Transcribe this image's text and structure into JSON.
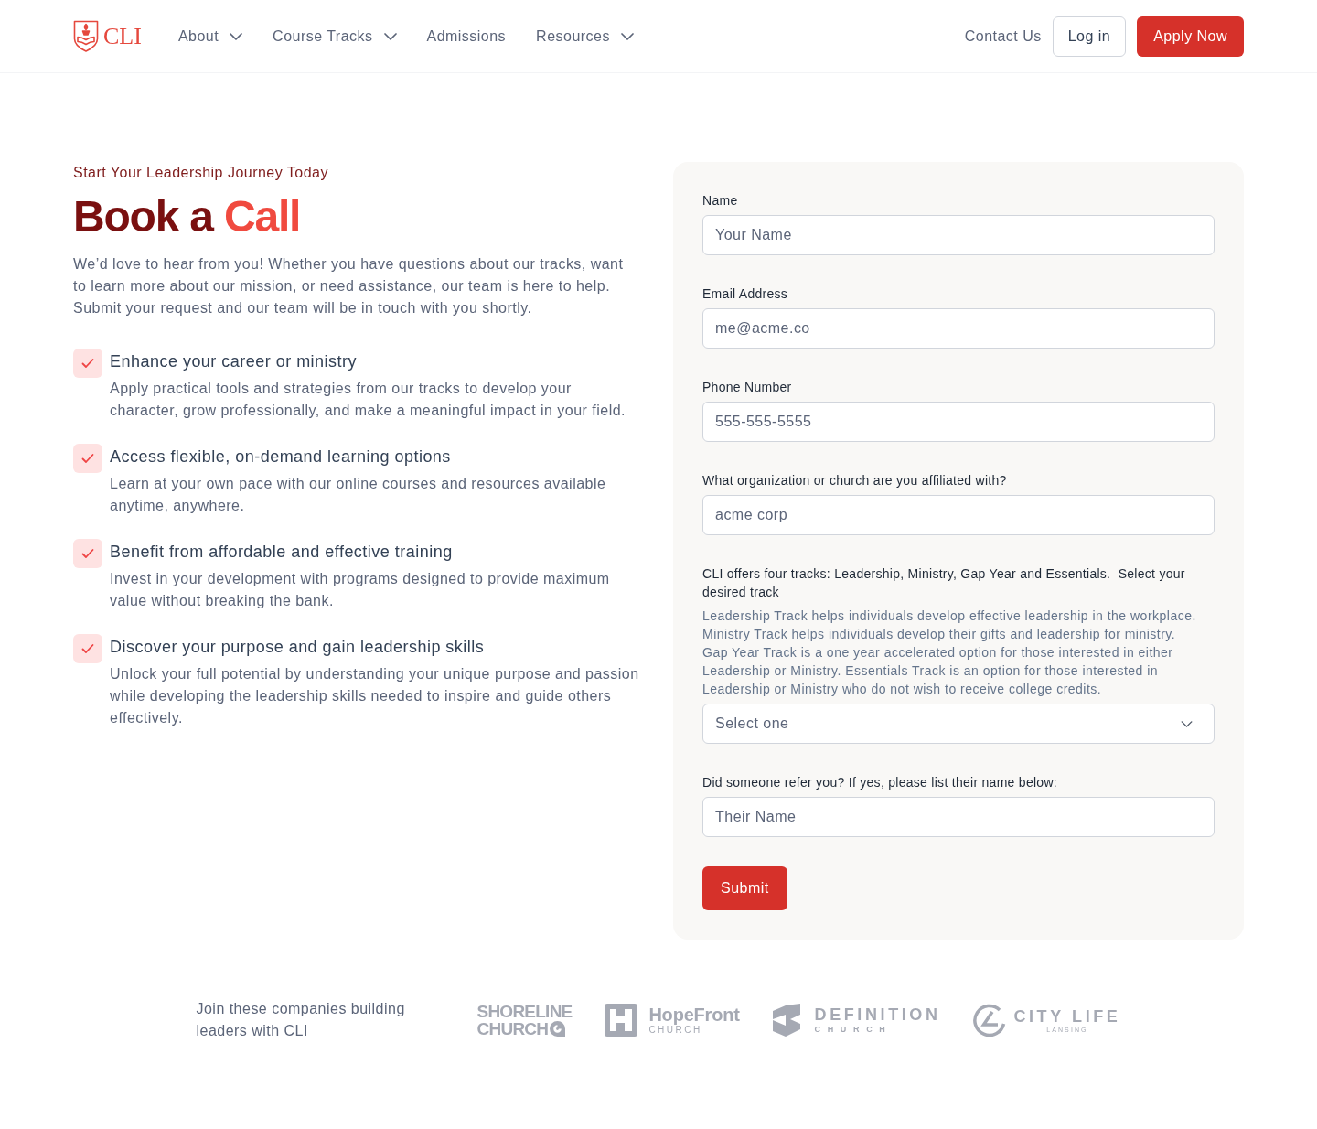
{
  "nav": {
    "logo": {
      "text": "CLI"
    },
    "items": [
      {
        "label": "About",
        "dropdown": true
      },
      {
        "label": "Course Tracks",
        "dropdown": true
      },
      {
        "label": "Admissions",
        "dropdown": false
      },
      {
        "label": "Resources",
        "dropdown": true
      }
    ],
    "contact": "Contact Us",
    "login": "Log in",
    "apply": "Apply Now"
  },
  "hero": {
    "eyebrow": "Start Your Leadership Journey Today",
    "title": [
      {
        "text": "Book a",
        "accent": false
      },
      {
        "text": "Call",
        "accent": true
      }
    ],
    "intro": "We’d love to hear from you! Whether you have questions about our tracks, want to learn more about our mission, or need assistance, our team is here to help. Submit your request and our team will be in touch with you shortly."
  },
  "features": [
    {
      "title": "Enhance your career or ministry",
      "body": "Apply practical tools and strategies from our tracks to develop your character, grow professionally, and make a meaningful impact in your field."
    },
    {
      "title": "Access flexible, on-demand learning options",
      "body": "Learn at your own pace with our online courses and resources available anytime, anywhere."
    },
    {
      "title": "Benefit from affordable and effective training",
      "body": "Invest in your development with programs designed to provide maximum value without breaking the bank."
    },
    {
      "title": "Discover your purpose and gain leadership skills",
      "body": "Unlock your full potential by understanding your unique purpose and passion while developing the leadership skills needed to inspire and guide others effectively."
    }
  ],
  "form": {
    "fields": [
      {
        "kind": "text",
        "label": "Name",
        "placeholder": "Your Name"
      },
      {
        "kind": "text",
        "label": "Email Address",
        "placeholder": "me@acme.co"
      },
      {
        "kind": "text",
        "label": "Phone Number",
        "placeholder": "555-555-5555"
      },
      {
        "kind": "text",
        "label": "What organization or church are you affiliated with?",
        "placeholder": "acme corp"
      },
      {
        "kind": "select",
        "label": "CLI offers four tracks: Leadership, Ministry, Gap Year and Essentials.  Select your desired track",
        "help": [
          "Leadership Track helps individuals develop effective leadership in the workplace.",
          "Ministry Track helps individuals develop their gifts and leadership for ministry.",
          "Gap Year Track is a one year accelerated option for those interested in either Leadership or Ministry. Essentials Track is an option for those interested in Leadership or Ministry who do not wish to receive college credits."
        ],
        "placeholder": "Select one"
      },
      {
        "kind": "text",
        "label": "Did someone refer you? If yes, please list their name below:",
        "placeholder": "Their Name"
      }
    ],
    "submit": "Submit"
  },
  "partners": {
    "caption": "Join these companies building leaders with CLI",
    "logos": [
      {
        "kind": "shoreline",
        "name": "SHORELINE",
        "subtitle": "CHURCH"
      },
      {
        "kind": "hopefront",
        "name": "HopeFront",
        "subtitle": "CHURCH"
      },
      {
        "kind": "definition",
        "name": "DEFINITION",
        "subtitle": "CHURCH"
      },
      {
        "kind": "citylife",
        "name": "CITY LIFE",
        "subtitle": "LANSING"
      }
    ]
  }
}
